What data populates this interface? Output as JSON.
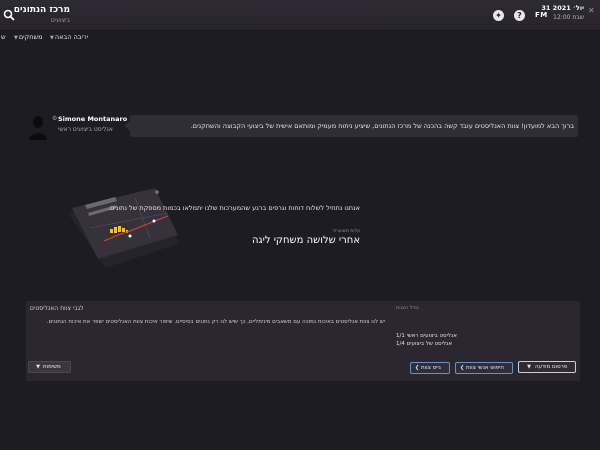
{
  "header": {
    "title": "מרכז הנתונים",
    "subtitle": "ביצועים",
    "date_line1": "31 יול׳ 2021",
    "date_line2": "12:00 שבת",
    "logo": "FM"
  },
  "nav": {
    "items": [
      {
        "label": "יריבה הבאה"
      },
      {
        "label": "משחקים"
      },
      {
        "label": "ש"
      }
    ]
  },
  "intro": {
    "name": "Simone Montanaro",
    "role": "אנליסט ביצועים ראשי",
    "message": "ברוך הבא למועדון! צוות האנליסטים עובד קשה בהכנה של מרכז הנתונים, שיציע ניתוח מעמיק ומותאם אישית של ביצועי הקבוצה והשחקנים."
  },
  "status": {
    "message": "אנחנו נתחיל לשלוח דוחות וגרפים ברגע שהמערכות שלנו יתמלאו בכמות מספקת של נתונים.",
    "eta_label": "עלות משוערת",
    "eta_value": "אחרי שלושה משחקי ליגה"
  },
  "panel": {
    "title": "לגבי צוות האנליסטים",
    "description": "יש לנו צוות אנליסטים באיכות נמוכה עם משאבים מינימליים, כך שיש לנו רק נתונים בסיסיים. שיפור איכות צוות האנליסטים ישפר את איכות הנתונים.",
    "staff_label": "גודל הצוות",
    "staff_lines": [
      "אנליסט ביצועים ראשי 1/1",
      "אנליסט של ביצועים 1/4"
    ],
    "buttons": {
      "dropdown": "משימות",
      "recruit": "גייס צוות",
      "search": "חיפוש אנשי צוות",
      "advert": "פרסום מודעה"
    }
  },
  "colors": {
    "accent_blue": "#6f8fc4",
    "chart_yellow": "#f2c230",
    "chart_red": "#e03a3a",
    "background": "#1e1c23"
  }
}
